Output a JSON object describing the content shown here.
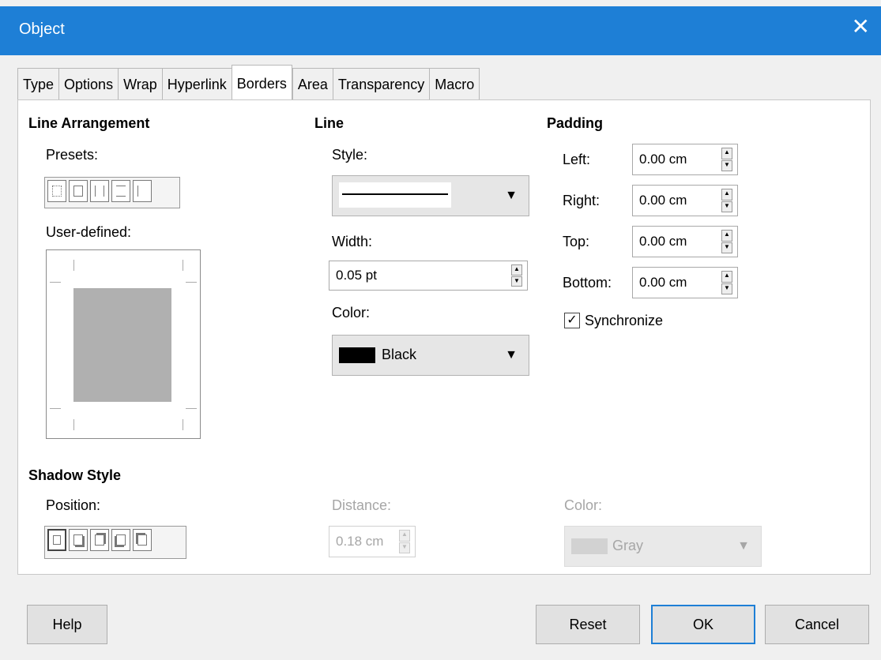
{
  "window": {
    "title": "Object",
    "close_glyph": "✕"
  },
  "tabs": [
    {
      "label": "Type"
    },
    {
      "label": "Options"
    },
    {
      "label": "Wrap"
    },
    {
      "label": "Hyperlink"
    },
    {
      "label": "Borders",
      "active": true
    },
    {
      "label": "Area"
    },
    {
      "label": "Transparency"
    },
    {
      "label": "Macro"
    }
  ],
  "line_arrangement": {
    "heading": "Line Arrangement",
    "presets_label": "Presets:",
    "user_defined_label": "User-defined:"
  },
  "line": {
    "heading": "Line",
    "style_label": "Style:",
    "width_label": "Width:",
    "width_value": "0.05 pt",
    "color_label": "Color:",
    "color_value": "Black",
    "color_swatch": "#000000"
  },
  "padding": {
    "heading": "Padding",
    "left_label": "Left:",
    "left_value": "0.00 cm",
    "right_label": "Right:",
    "right_value": "0.00 cm",
    "top_label": "Top:",
    "top_value": "0.00 cm",
    "bottom_label": "Bottom:",
    "bottom_value": "0.00 cm",
    "synchronize_label": "Synchronize",
    "synchronize_checked": true
  },
  "shadow": {
    "heading": "Shadow Style",
    "position_label": "Position:",
    "distance_label": "Distance:",
    "distance_value": "0.18 cm",
    "color_label": "Color:",
    "color_value": "Gray",
    "color_swatch": "#c8c8c8"
  },
  "buttons": {
    "help": "Help",
    "reset": "Reset",
    "ok": "OK",
    "cancel": "Cancel"
  },
  "icons": {
    "close": "close-icon",
    "dropdown": "chevron-down-icon",
    "spin_up": "spin-up-icon",
    "spin_down": "spin-down-icon"
  },
  "colors": {
    "titlebar": "#1e7fd6",
    "accent": "#1e7fd6"
  }
}
